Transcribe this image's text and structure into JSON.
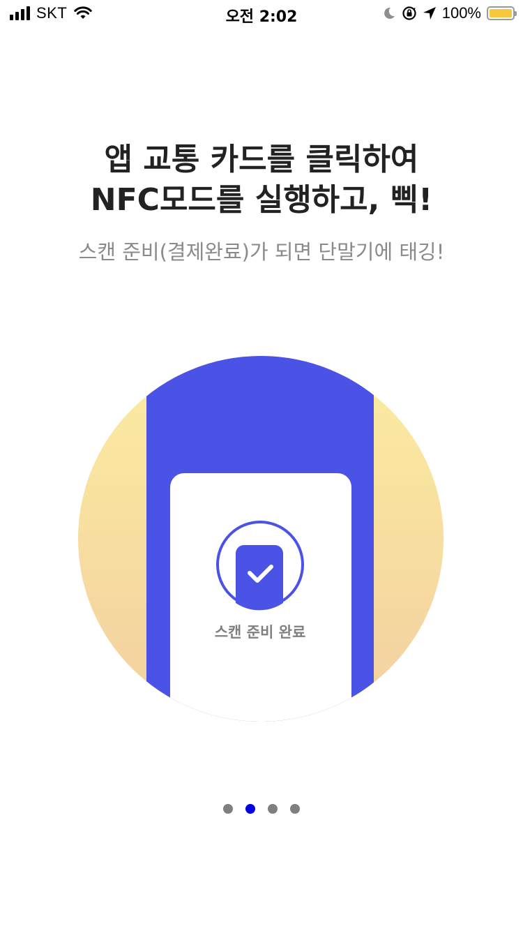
{
  "status_bar": {
    "carrier": "SKT",
    "time": "오전 2:02",
    "battery": "100%",
    "battery_level": 1.0
  },
  "content": {
    "title_line1": "앱 교통 카드를 클릭하여",
    "title_line2": "NFC모드를 실행하고, 삑!",
    "subtitle": "스캔 준비(결제완료)가 되면 단말기에 태깅!",
    "card_status_label": "스캔 준비 완료"
  },
  "pager": {
    "count": 4,
    "active_index": 1
  },
  "colors": {
    "accent": "#4B52E6",
    "active_dot": "#0000E6",
    "inactive_dot": "#7F7F7F",
    "gradient_top": "#FCEDA0",
    "gradient_bottom": "#F2CFA0",
    "battery": "#F7C83F"
  }
}
